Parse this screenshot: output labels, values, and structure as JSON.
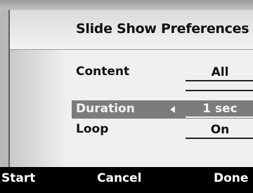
{
  "title": "Slide Show Preferences",
  "rows": {
    "content": {
      "label": "Content",
      "value": "All"
    },
    "duration": {
      "label": "Duration",
      "value": "1 sec"
    },
    "loop": {
      "label": "Loop",
      "value": "On"
    }
  },
  "softkeys": {
    "left": "Start",
    "center": "Cancel",
    "right": "Done"
  }
}
